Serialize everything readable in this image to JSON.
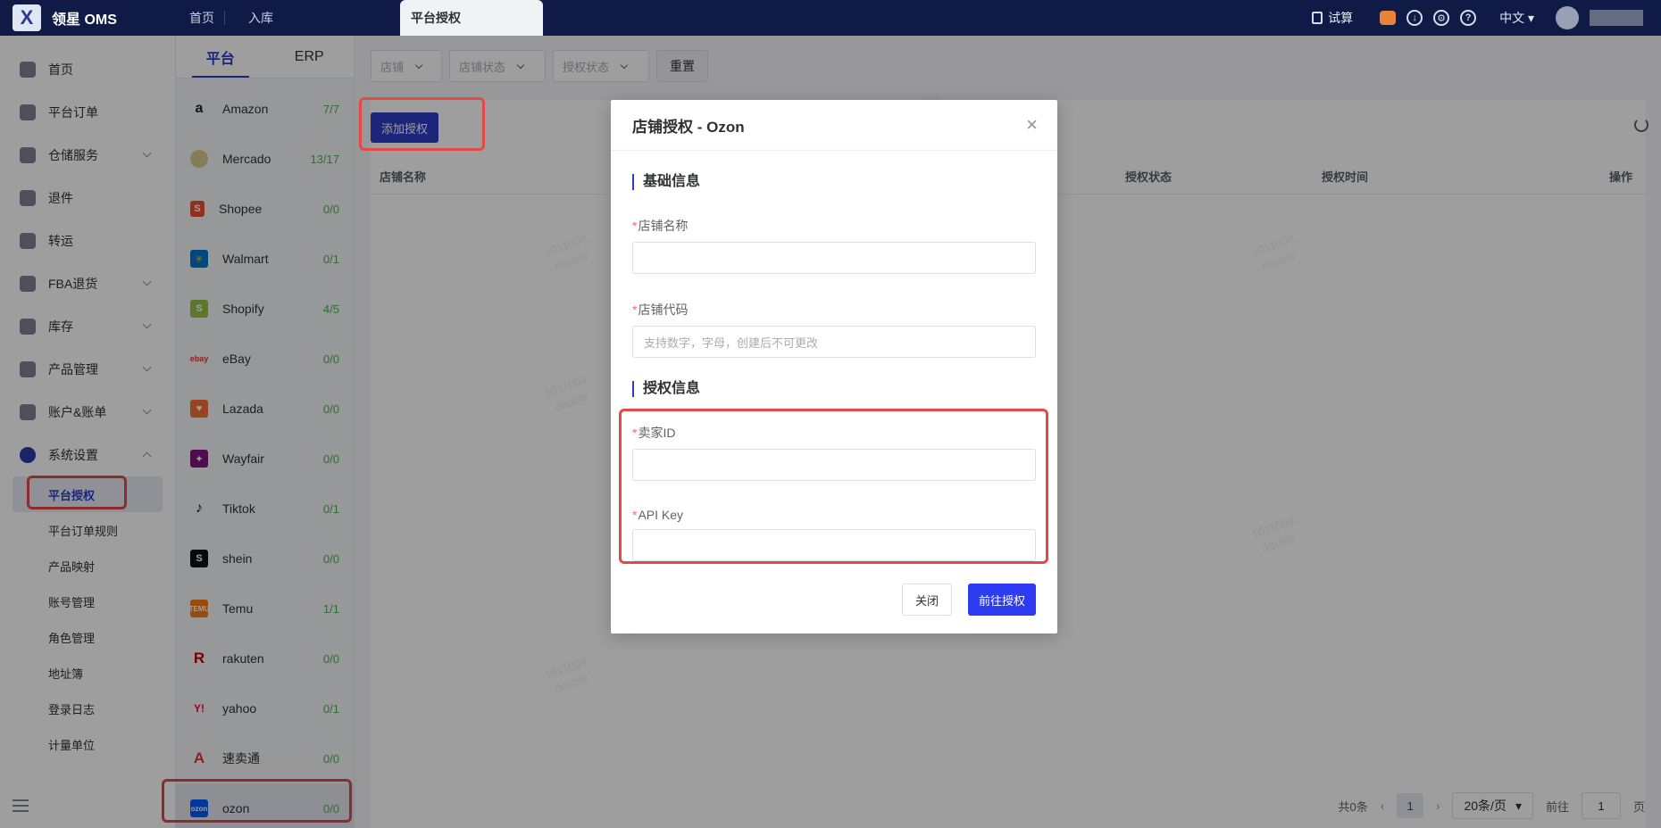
{
  "app": {
    "title": "领星 OMS"
  },
  "topbar": {
    "tabs": [
      {
        "label": "首页"
      },
      {
        "label": "入库"
      },
      {
        "label": "平台授权"
      }
    ],
    "trial_label": "试算",
    "language": "中文"
  },
  "sidebar": {
    "items": [
      {
        "label": "首页"
      },
      {
        "label": "平台订单"
      },
      {
        "label": "仓储服务"
      },
      {
        "label": "退件"
      },
      {
        "label": "转运"
      },
      {
        "label": "FBA退货"
      },
      {
        "label": "库存"
      },
      {
        "label": "产品管理"
      },
      {
        "label": "账户&账单"
      },
      {
        "label": "系统设置"
      }
    ],
    "subitems": [
      {
        "label": "平台授权"
      },
      {
        "label": "平台订单规则"
      },
      {
        "label": "产品映射"
      },
      {
        "label": "账号管理"
      },
      {
        "label": "角色管理"
      },
      {
        "label": "地址簿"
      },
      {
        "label": "登录日志"
      },
      {
        "label": "计量单位"
      }
    ]
  },
  "platforms": {
    "tabs": [
      {
        "label": "平台"
      },
      {
        "label": "ERP"
      }
    ],
    "items": [
      {
        "name": "Amazon",
        "count": "7/7"
      },
      {
        "name": "Mercado",
        "count": "13/17"
      },
      {
        "name": "Shopee",
        "count": "0/0"
      },
      {
        "name": "Walmart",
        "count": "0/1"
      },
      {
        "name": "Shopify",
        "count": "4/5"
      },
      {
        "name": "eBay",
        "count": "0/0"
      },
      {
        "name": "Lazada",
        "count": "0/0"
      },
      {
        "name": "Wayfair",
        "count": "0/0"
      },
      {
        "name": "Tiktok",
        "count": "0/1"
      },
      {
        "name": "shein",
        "count": "0/0"
      },
      {
        "name": "Temu",
        "count": "1/1"
      },
      {
        "name": "rakuten",
        "count": "0/0"
      },
      {
        "name": "yahoo",
        "count": "0/1"
      },
      {
        "name": "速卖通",
        "count": "0/0"
      },
      {
        "name": "ozon",
        "count": "0/0"
      }
    ]
  },
  "filters": {
    "shop_placeholder": "店铺",
    "shop_status_placeholder": "店铺状态",
    "auth_status_placeholder": "授权状态",
    "reset_label": "重置"
  },
  "toolbar": {
    "add_auth_label": "添加授权"
  },
  "table": {
    "columns": [
      "店铺名称",
      "授权状态",
      "授权时间",
      "操作"
    ]
  },
  "pagination": {
    "total_label": "共0条",
    "current_page": "1",
    "page_size": "20条/页",
    "goto_label": "前往",
    "goto_value": "1",
    "page_unit": "页"
  },
  "dialog": {
    "title": "店铺授权 - Ozon",
    "section_basic": "基础信息",
    "shop_name_label": "店铺名称",
    "shop_code_label": "店铺代码",
    "shop_code_placeholder": "支持数字，字母，创建后不可更改",
    "section_auth": "授权信息",
    "seller_id_label": "卖家ID",
    "api_key_label": "API Key",
    "close_label": "关闭",
    "submit_label": "前往授权"
  },
  "watermark": {
    "line1": "1011004",
    "line2": "double"
  }
}
